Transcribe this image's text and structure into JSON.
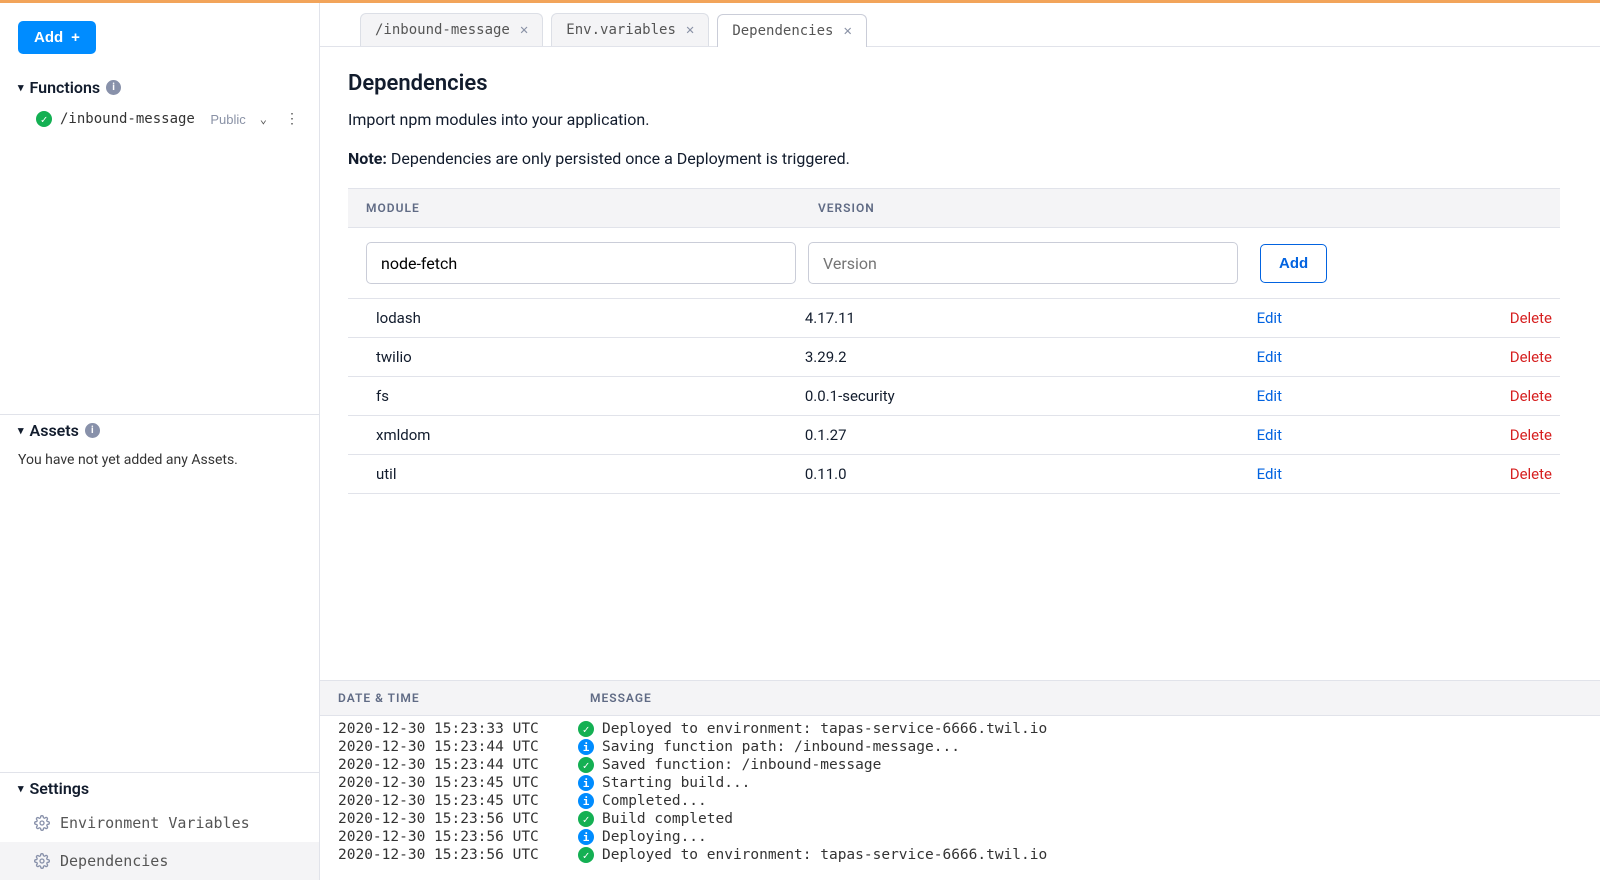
{
  "sidebar": {
    "add_label": "Add",
    "functions_label": "Functions",
    "functions": [
      {
        "name": "/inbound-message",
        "visibility": "Public"
      }
    ],
    "assets_label": "Assets",
    "assets_empty_msg": "You have not yet added any Assets.",
    "settings_label": "Settings",
    "settings": [
      {
        "label": "Environment Variables",
        "active": false
      },
      {
        "label": "Dependencies",
        "active": true
      }
    ]
  },
  "tabs": [
    {
      "label": "/inbound-message",
      "active": false
    },
    {
      "label": "Env.variables",
      "active": false
    },
    {
      "label": "Dependencies",
      "active": true
    }
  ],
  "content": {
    "title": "Dependencies",
    "subtitle": "Import npm modules into your application.",
    "note_prefix": "Note:",
    "note_text": " Dependencies are only persisted once a Deployment is triggered.",
    "headers": {
      "module": "MODULE",
      "version": "VERSION"
    },
    "add": {
      "module_value": "node-fetch",
      "version_placeholder": "Version",
      "button": "Add"
    },
    "edit_label": "Edit",
    "delete_label": "Delete",
    "rows": [
      {
        "module": "lodash",
        "version": "4.17.11"
      },
      {
        "module": "twilio",
        "version": "3.29.2"
      },
      {
        "module": "fs",
        "version": "0.0.1-security"
      },
      {
        "module": "xmldom",
        "version": "0.1.27"
      },
      {
        "module": "util",
        "version": "0.11.0"
      }
    ]
  },
  "log": {
    "headers": {
      "date": "DATE & TIME",
      "message": "MESSAGE"
    },
    "rows": [
      {
        "ts": "2020-12-30 15:23:33 UTC",
        "kind": "success",
        "msg": "Deployed to environment: tapas-service-6666.twil.io"
      },
      {
        "ts": "2020-12-30 15:23:44 UTC",
        "kind": "info",
        "msg": "Saving function path: /inbound-message..."
      },
      {
        "ts": "2020-12-30 15:23:44 UTC",
        "kind": "success",
        "msg": "Saved function: /inbound-message"
      },
      {
        "ts": "2020-12-30 15:23:45 UTC",
        "kind": "info",
        "msg": "Starting build..."
      },
      {
        "ts": "2020-12-30 15:23:45 UTC",
        "kind": "info",
        "msg": "Completed..."
      },
      {
        "ts": "2020-12-30 15:23:56 UTC",
        "kind": "success",
        "msg": "Build completed"
      },
      {
        "ts": "2020-12-30 15:23:56 UTC",
        "kind": "info",
        "msg": "Deploying..."
      },
      {
        "ts": "2020-12-30 15:23:56 UTC",
        "kind": "success",
        "msg": "Deployed to environment: tapas-service-6666.twil.io"
      }
    ]
  }
}
